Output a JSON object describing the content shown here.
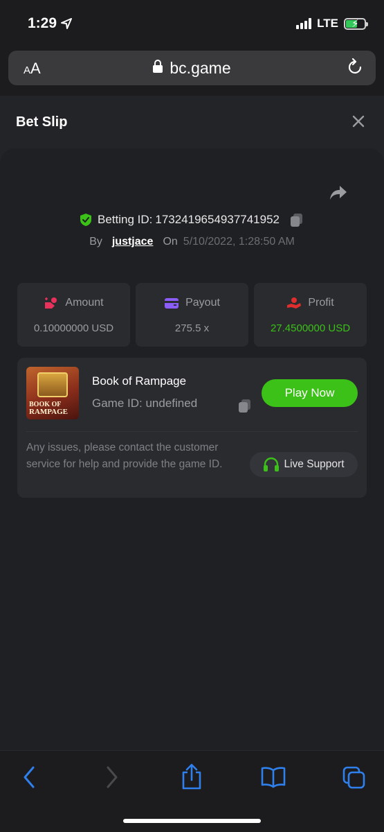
{
  "status": {
    "time": "1:29",
    "network": "LTE"
  },
  "url_bar": {
    "aa_label": "AA",
    "url": "bc.game"
  },
  "header": {
    "title": "Bet Slip"
  },
  "bet": {
    "id_label": "Betting ID:",
    "id_value": "1732419654937741952",
    "by_label": "By",
    "user": "justjace",
    "on_label": "On",
    "date": "5/10/2022, 1:28:50 AM"
  },
  "stats": [
    {
      "label": "Amount",
      "value": "0.10000000 USD",
      "icon": "amount-icon",
      "color": "#e8315b"
    },
    {
      "label": "Payout",
      "value": "275.5 x",
      "icon": "wallet-icon",
      "color": "#8b5cf6"
    },
    {
      "label": "Profit",
      "value": "27.4500000 USD",
      "icon": "profit-icon",
      "color": "#e02d2d"
    }
  ],
  "game": {
    "thumb_text_line1": "BOOK OF",
    "thumb_text_line2": "RAMPAGE",
    "name": "Book of Rampage",
    "id_text": "Game ID: undefined",
    "play_label": "Play Now",
    "issue_text": "Any issues, please contact the customer service for help and provide the game ID.",
    "support_label": "Live Support"
  },
  "colors": {
    "accent_green": "#3bc117",
    "background": "#18191c",
    "panel": "#232428"
  }
}
